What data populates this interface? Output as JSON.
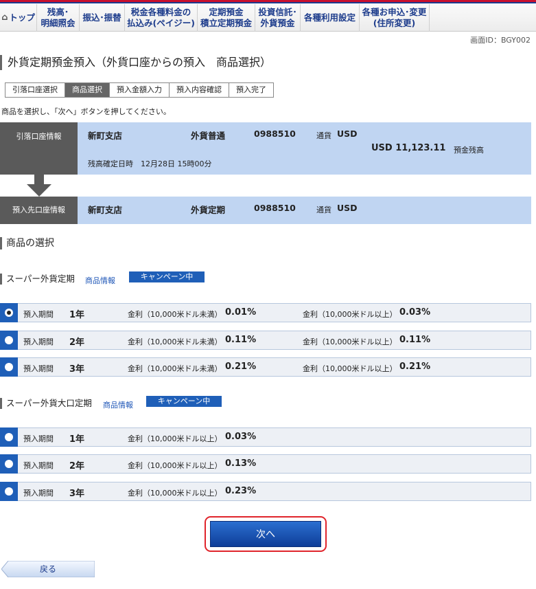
{
  "nav": {
    "items": [
      {
        "label": "トップ"
      },
      {
        "label": "残高･\n明細照会"
      },
      {
        "label": "振込･振替"
      },
      {
        "label": "税金各種料金の\n払込み(ペイジー)"
      },
      {
        "label": "定期預金\n積立定期預金"
      },
      {
        "label": "投資信託･\n外貨預金"
      },
      {
        "label": "各種利用設定"
      },
      {
        "label": "各種お申込･変更\n(住所変更)"
      }
    ]
  },
  "screen_id": "画面ID：BGY002",
  "page_title": "外貨定期預金預入（外貨口座からの預入　商品選択）",
  "steps": [
    "引落口座選択",
    "商品選択",
    "預入金額入力",
    "預入内容確認",
    "預入完了"
  ],
  "instruction": "商品を選択し、「次へ」ボタンを押してください。",
  "withdraw_account": {
    "label": "引落口座情報",
    "branch": "新町支店",
    "type": "外貨普通",
    "number": "0988510",
    "currency_label": "通貨",
    "currency": "USD",
    "balance": "USD 11,123.11",
    "balance_label": "預金残高",
    "balance_time": "残高確定日時　12月28日 15時00分"
  },
  "deposit_account": {
    "label": "預入先口座情報",
    "branch": "新町支店",
    "type": "外貨定期",
    "number": "0988510",
    "currency_label": "通貨",
    "currency": "USD"
  },
  "section_title": "商品の選択",
  "products": [
    {
      "name": "スーパー外貨定期",
      "info_link": "商品情報",
      "campaign": "キャンペーン中",
      "rows": [
        {
          "period_label": "預入期間",
          "period": "1年",
          "rate1_label": "金利（10,000米ドル未満）",
          "rate1": "0.01%",
          "rate2_label": "金利（10,000米ドル以上）",
          "rate2": "0.03%",
          "selected": true
        },
        {
          "period_label": "預入期間",
          "period": "2年",
          "rate1_label": "金利（10,000米ドル未満）",
          "rate1": "0.11%",
          "rate2_label": "金利（10,000米ドル以上）",
          "rate2": "0.11%",
          "selected": false
        },
        {
          "period_label": "預入期間",
          "period": "3年",
          "rate1_label": "金利（10,000米ドル未満）",
          "rate1": "0.21%",
          "rate2_label": "金利（10,000米ドル以上）",
          "rate2": "0.21%",
          "selected": false
        }
      ]
    },
    {
      "name": "スーパー外貨大口定期",
      "info_link": "商品情報",
      "campaign": "キャンペーン中",
      "rows": [
        {
          "period_label": "預入期間",
          "period": "1年",
          "rate1_label": "金利（10,000米ドル以上）",
          "rate1": "0.03%",
          "selected": false
        },
        {
          "period_label": "預入期間",
          "period": "2年",
          "rate1_label": "金利（10,000米ドル以上）",
          "rate1": "0.13%",
          "selected": false
        },
        {
          "period_label": "預入期間",
          "period": "3年",
          "rate1_label": "金利（10,000米ドル以上）",
          "rate1": "0.23%",
          "selected": false
        }
      ]
    }
  ],
  "buttons": {
    "next": "次へ",
    "back": "戻る"
  }
}
